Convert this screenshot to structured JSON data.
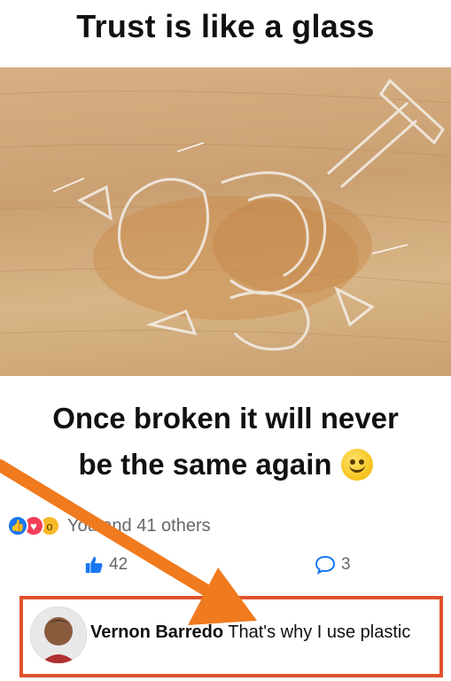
{
  "meme": {
    "title": "Trust is like a glass",
    "caption_line1": "Once broken it will never",
    "caption_line2": "be the same again"
  },
  "post": {
    "reactions_text": "You and 41 others",
    "reaction_icons": [
      "like-icon",
      "love-icon",
      "wow-icon"
    ],
    "like_count": "42",
    "comment_count": "3"
  },
  "comment": {
    "author": "Vernon Barredo",
    "text": "That's why I use plastic"
  },
  "colors": {
    "annotation_orange": "#e0522c",
    "like_blue": "#1877f2",
    "love_red": "#f33e58",
    "wow_yellow": "#f7b928"
  }
}
